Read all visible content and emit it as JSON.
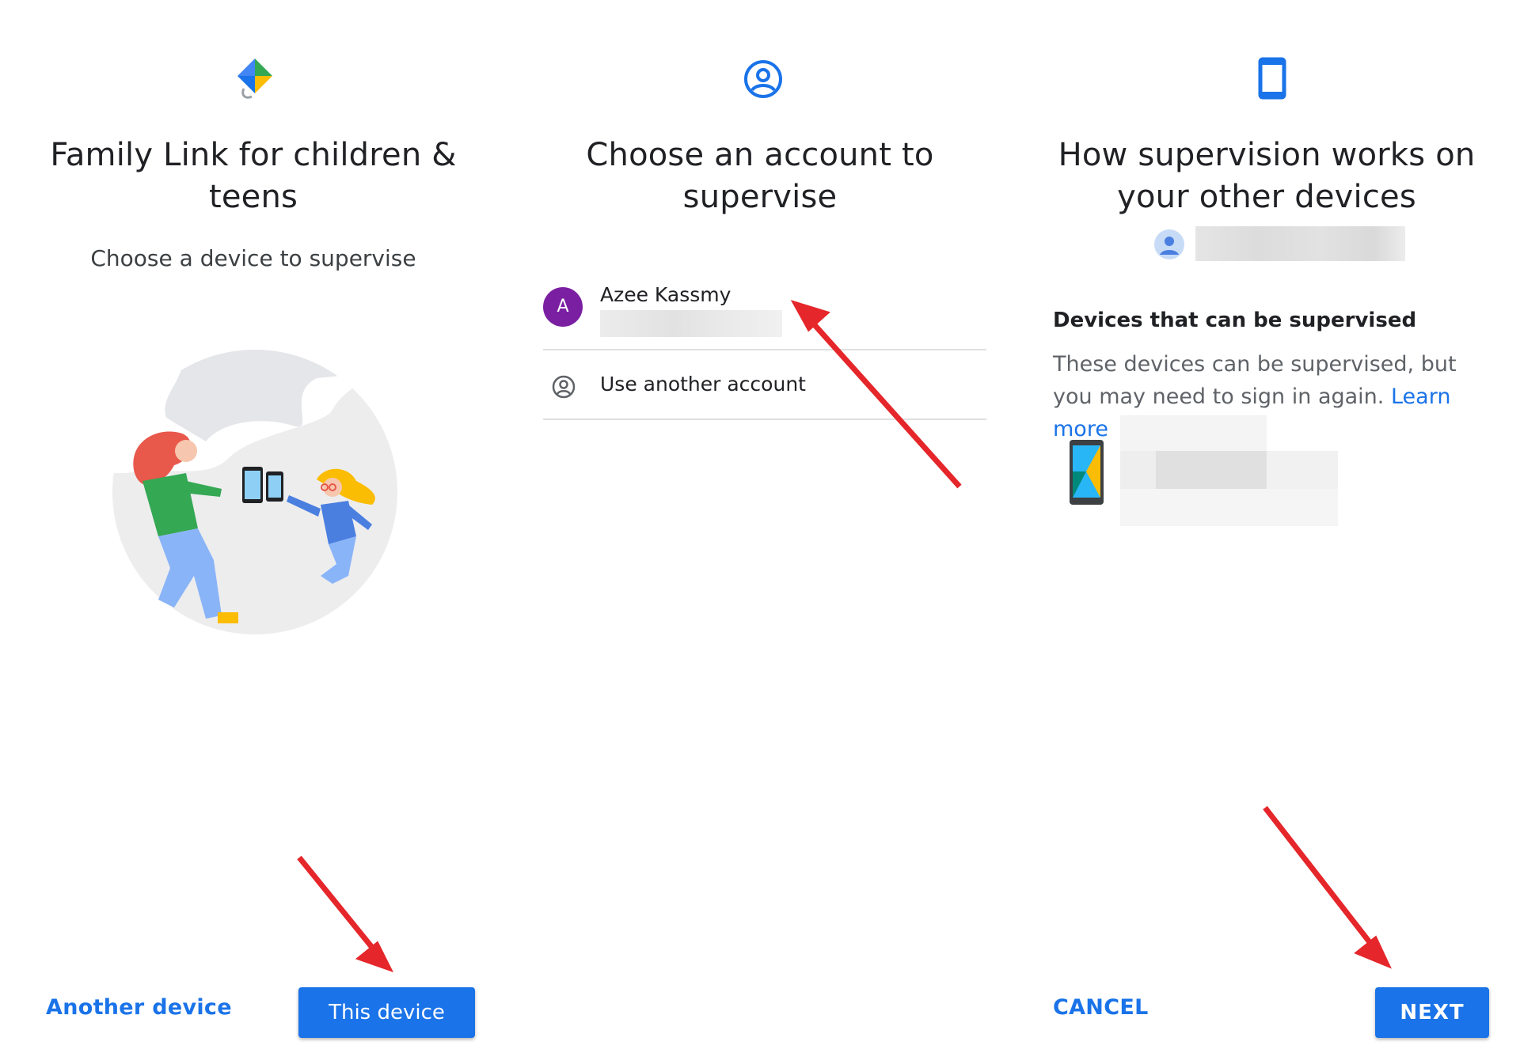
{
  "panels": [
    {
      "title": "Family Link for children & teens",
      "subtitle": "Choose a device to supervise",
      "buttons": {
        "secondary": "Another device",
        "primary": "This device"
      }
    },
    {
      "title": "Choose an account to supervise",
      "accounts": [
        {
          "avatar_letter": "A",
          "name": "Azee Kassmy"
        }
      ],
      "use_another": "Use another account"
    },
    {
      "title": "How supervision works on your other devices",
      "section_heading": "Devices that can be supervised",
      "section_body": "These devices can be supervised, but you may need to sign in again.",
      "learn_more": "Learn more",
      "buttons": {
        "cancel": "CANCEL",
        "next": "NEXT"
      }
    }
  ],
  "colors": {
    "accent": "#1a73e8",
    "avatar": "#7b1fa2",
    "annotation_arrow": "#e5262a"
  },
  "icons": [
    "family-link-logo-icon",
    "account-circle-icon",
    "phone-icon",
    "person-circle-icon",
    "annotation-arrow"
  ]
}
